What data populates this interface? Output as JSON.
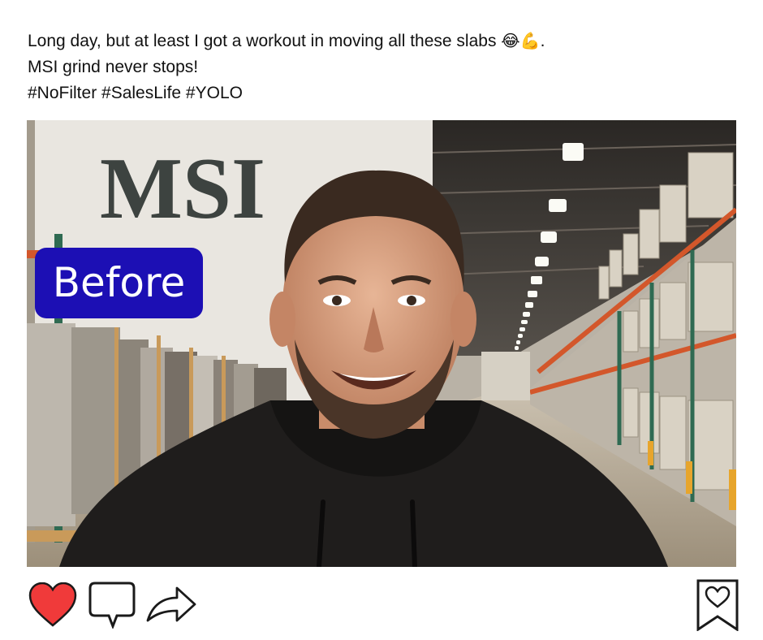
{
  "post": {
    "caption_lines": [
      "Long day, but at least I got a workout in moving all these slabs",
      "MSI grind never stops!",
      "#NoFilter #SalesLife #YOLO"
    ],
    "caption_emoji": "😂💪",
    "caption_end": "."
  },
  "image": {
    "sign_text": "MSI",
    "badge_label": "Before"
  },
  "actions": {
    "like_icon": "heart-icon",
    "comment_icon": "comment-bubble-icon",
    "share_icon": "share-arrow-icon",
    "save_icon": "bookmark-heart-icon",
    "liked": true,
    "like_color": "#f03a3a"
  }
}
